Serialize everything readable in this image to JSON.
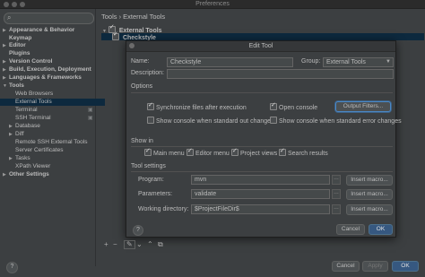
{
  "window": {
    "title": "Preferences"
  },
  "sidebar": {
    "items": [
      {
        "label": "Appearance & Behavior",
        "bold": true,
        "arrow": "▶"
      },
      {
        "label": "Keymap",
        "bold": true,
        "arrow": ""
      },
      {
        "label": "Editor",
        "bold": true,
        "arrow": "▶"
      },
      {
        "label": "Plugins",
        "bold": true,
        "arrow": ""
      },
      {
        "label": "Version Control",
        "bold": true,
        "arrow": "▶"
      },
      {
        "label": "Build, Execution, Deployment",
        "bold": true,
        "arrow": "▶"
      },
      {
        "label": "Languages & Frameworks",
        "bold": true,
        "arrow": "▶"
      },
      {
        "label": "Tools",
        "bold": true,
        "arrow": "▼"
      },
      {
        "label": "Web Browsers",
        "bold": false,
        "arrow": ""
      },
      {
        "label": "External Tools",
        "bold": false,
        "arrow": ""
      },
      {
        "label": "Terminal",
        "bold": false,
        "arrow": ""
      },
      {
        "label": "SSH Terminal",
        "bold": false,
        "arrow": ""
      },
      {
        "label": "Database",
        "bold": false,
        "arrow": "▶"
      },
      {
        "label": "Diff",
        "bold": false,
        "arrow": "▶"
      },
      {
        "label": "Remote SSH External Tools",
        "bold": false,
        "arrow": ""
      },
      {
        "label": "Server Certificates",
        "bold": false,
        "arrow": ""
      },
      {
        "label": "Tasks",
        "bold": false,
        "arrow": "▶"
      },
      {
        "label": "XPath Viewer",
        "bold": false,
        "arrow": ""
      },
      {
        "label": "Other Settings",
        "bold": true,
        "arrow": "▶"
      }
    ]
  },
  "header": {
    "breadcrumb": "Tools › External Tools"
  },
  "tools_tree": {
    "group": "External Tools",
    "tool": "Checkstyle"
  },
  "dialog": {
    "title": "Edit Tool",
    "name_label": "Name:",
    "name_value": "Checkstyle",
    "group_label": "Group:",
    "group_value": "External Tools",
    "description_label": "Description:",
    "description_value": "",
    "options_label": "Options",
    "sync_files": "Synchronize files after execution",
    "open_console": "Open console",
    "output_filters": "Output Filters...",
    "console_stdout": "Show console when standard out changes",
    "console_stderr": "Show console when standard error changes",
    "show_in_label": "Show in",
    "main_menu": "Main menu",
    "editor_menu": "Editor menu",
    "project_views": "Project views",
    "search_results": "Search results",
    "tool_settings_label": "Tool settings",
    "program_label": "Program:",
    "program_value": "mvn",
    "parameters_label": "Parameters:",
    "parameters_value": "validate",
    "working_dir_label": "Working directory:",
    "working_dir_value": "$ProjectFileDir$",
    "insert_macro": "Insert macro...",
    "cancel": "Cancel",
    "ok": "OK",
    "help": "?"
  },
  "footer": {
    "help": "?",
    "cancel": "Cancel",
    "apply": "Apply",
    "ok": "OK"
  }
}
